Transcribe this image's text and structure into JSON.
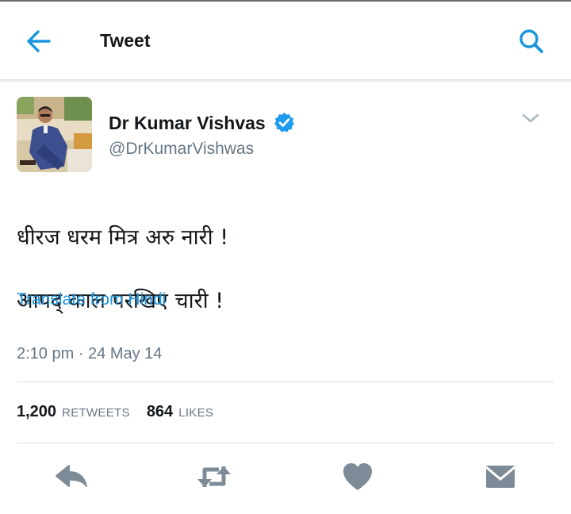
{
  "header": {
    "title": "Tweet",
    "back_icon": "arrow-left-icon",
    "search_icon": "search-icon"
  },
  "user": {
    "name": "Dr Kumar Vishvas",
    "handle": "@DrKumarVishwas",
    "verified_icon": "verified-badge-icon"
  },
  "tweet": {
    "lines": [
      "धीरज धरम मित्र अरु नारी !",
      "आपद् काल परखिए चारी !"
    ],
    "translate_label": "Translate from Hindi",
    "timestamp": "2:10 pm · 24 May 14"
  },
  "stats": {
    "retweets_count": "1,200",
    "retweets_label": "RETWEETS",
    "likes_count": "864",
    "likes_label": "LIKES"
  },
  "actions": [
    "reply-icon",
    "retweet-icon",
    "like-icon",
    "direct-message-icon"
  ],
  "colors": {
    "accent": "#1b95e0",
    "icon_gray": "#7d8b98",
    "text": "#14171a",
    "secondary_text": "#657786",
    "divider": "#d8dee3"
  }
}
